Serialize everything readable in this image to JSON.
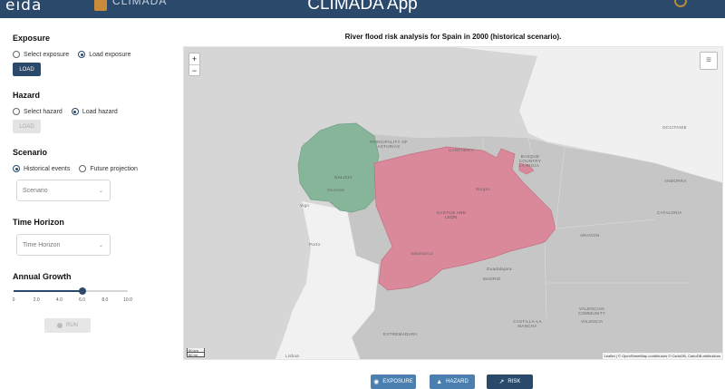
{
  "header": {
    "logo_left": "eida",
    "logo_right": "CLIMADA",
    "title": "CLIMADA App"
  },
  "sidebar": {
    "exposure": {
      "title": "Exposure",
      "options": [
        "Select exposure",
        "Load exposure"
      ],
      "selected": "Load exposure",
      "button": "LOAD"
    },
    "hazard": {
      "title": "Hazard",
      "options": [
        "Select hazard",
        "Load hazard"
      ],
      "selected": "Load hazard",
      "button": "LOAD"
    },
    "scenario": {
      "title": "Scenario",
      "options": [
        "Historical events",
        "Future projection"
      ],
      "selected": "Historical events",
      "select_placeholder": "Scenario"
    },
    "time_horizon": {
      "title": "Time Horizon",
      "select_placeholder": "Time Horizon"
    },
    "annual_growth": {
      "title": "Annual Growth",
      "value": 6.0,
      "min": 0,
      "max": 10.0,
      "ticks": [
        "0",
        "2.0",
        "4.0",
        "6.0",
        "8.0",
        "10.0"
      ]
    },
    "run_button": "RUN"
  },
  "map": {
    "title": "River flood risk analysis for Spain in 2000 (historical scenario).",
    "zoom_in": "+",
    "zoom_out": "−",
    "scale": [
      "50 km",
      "50 mi"
    ],
    "attribution": "Leaflet | © OpenStreetMap contributors © CartoDB, CartoDB attributions",
    "labels": {
      "asturias": "PRINCIPALITY OF ASTURIAS",
      "cantabria": "CANTABRIA",
      "basque": "BASQUE COUNTRY",
      "rioja": "LA RIOJA",
      "galicia": "GALICIA",
      "castile_leon": "CASTILE AND LEÓN",
      "aragon": "ARAGON",
      "catalonia": "CATALONIA",
      "andorra": "ANDORRA",
      "occitanie": "OCCITANIE",
      "madrid": "MADRID",
      "extremadura": "EXTREMADURA",
      "castilla_mancha": "CASTILLA-LA MANCHA",
      "valencian": "VALENCIAN COMMUNITY",
      "valencia": "VALENCIA",
      "burgos": "Burgos",
      "salamanca": "Salamanca",
      "guadalajara": "Guadalajara",
      "vigo": "Vigo",
      "ourense": "Ourense",
      "porto": "Porto",
      "lisboa": "Lisboa"
    },
    "colors": {
      "galicia": "#86b59a",
      "castile_leon": "#d9899a",
      "land": "#c9c9c9",
      "sea": "#d7d7d7",
      "portugal": "#f1f1f1"
    }
  },
  "tabs": {
    "exposure": "EXPOSURE",
    "hazard": "HAZARD",
    "risk": "RISK"
  }
}
